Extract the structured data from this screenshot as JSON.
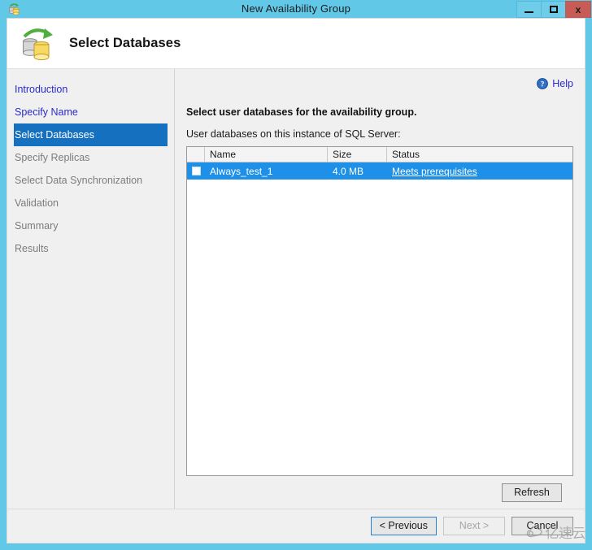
{
  "window": {
    "title": "New Availability Group",
    "icon": "availability-group-icon",
    "controls": {
      "minimize": "–",
      "maximize": "□",
      "close": "x"
    }
  },
  "banner": {
    "title": "Select Databases",
    "icon": "database-sync-icon"
  },
  "sidebar": {
    "items": [
      {
        "label": "Introduction",
        "state": "link"
      },
      {
        "label": "Specify Name",
        "state": "link"
      },
      {
        "label": "Select Databases",
        "state": "active"
      },
      {
        "label": "Specify Replicas",
        "state": "disabled"
      },
      {
        "label": "Select Data Synchronization",
        "state": "disabled"
      },
      {
        "label": "Validation",
        "state": "disabled"
      },
      {
        "label": "Summary",
        "state": "disabled"
      },
      {
        "label": "Results",
        "state": "disabled"
      }
    ]
  },
  "content": {
    "help_label": "Help",
    "help_icon": "help-circle-icon",
    "heading": "Select user databases for the availability group.",
    "subheading": "User databases on this instance of SQL Server:",
    "grid": {
      "columns": [
        "",
        "Name",
        "Size",
        "Status"
      ],
      "rows": [
        {
          "checked": false,
          "name": "Always_test_1",
          "size": "4.0 MB",
          "status": "Meets prerequisites"
        }
      ]
    },
    "refresh_label": "Refresh"
  },
  "footer": {
    "previous_label": "< Previous",
    "next_label": "Next >",
    "cancel_label": "Cancel"
  },
  "watermark": {
    "text": "亿速云"
  },
  "colors": {
    "titlebar": "#62c8e8",
    "accent_selected": "#1570c0",
    "grid_row_selected": "#1e90e8",
    "link": "#2a2ad0",
    "close_button": "#c75b55"
  }
}
